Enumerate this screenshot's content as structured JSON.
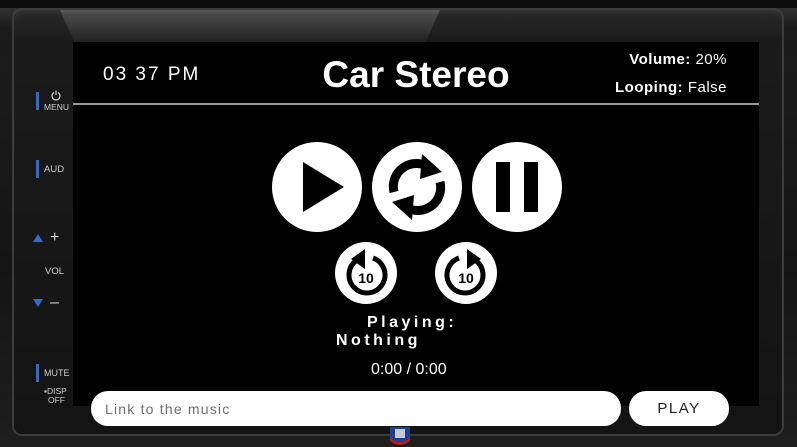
{
  "header": {
    "clock": "03 37 PM",
    "title": "Car Stereo",
    "volume_label": "Volume:",
    "volume_value": "20%",
    "looping_label": "Looping:",
    "looping_value": "False"
  },
  "side_panel": {
    "menu_label": "MENU",
    "aud_label": "AUD",
    "vol_label": "VOL",
    "mute_label": "MUTE",
    "disp_label": "▪DISP",
    "off_label": "OFF"
  },
  "controls": {
    "play_icon": "play-icon",
    "loop_icon": "loop-icon",
    "pause_icon": "pause-icon",
    "rewind_label": "10",
    "forward_label": "10"
  },
  "now_playing": {
    "label": "Playing:",
    "value": "Nothing",
    "time": "0:00 / 0:00"
  },
  "footer": {
    "link_placeholder": "Link to the music",
    "link_value": "",
    "play_label": "PLAY"
  },
  "colors": {
    "accent": "#2f6bd1",
    "screen": "#000000",
    "button": "#ffffff"
  }
}
